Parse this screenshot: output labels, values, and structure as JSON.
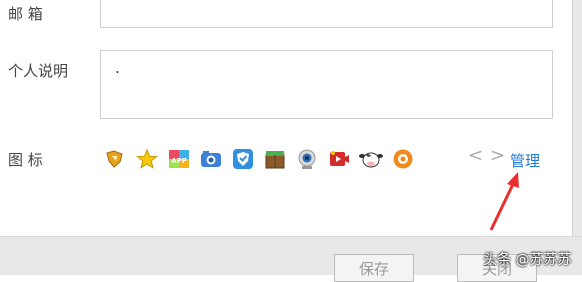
{
  "form": {
    "email_label": "邮    箱",
    "bio_label": "个人说明",
    "bio_value": ".",
    "icon_label": "图    标"
  },
  "icons": {
    "items": [
      "heart-badge-icon",
      "star-icon",
      "app-icon",
      "camera-icon",
      "shield-icon",
      "crate-icon",
      "webcam-icon",
      "video-icon",
      "cow-icon",
      "orange-circle-icon"
    ],
    "prev": "<",
    "next": ">",
    "manage": "管理"
  },
  "buttons": {
    "save": "保存",
    "close": "关闭"
  },
  "watermark": "头条 @苏苏苏",
  "colors": {
    "link": "#1f7bd0",
    "arrow": "#e8312f"
  }
}
